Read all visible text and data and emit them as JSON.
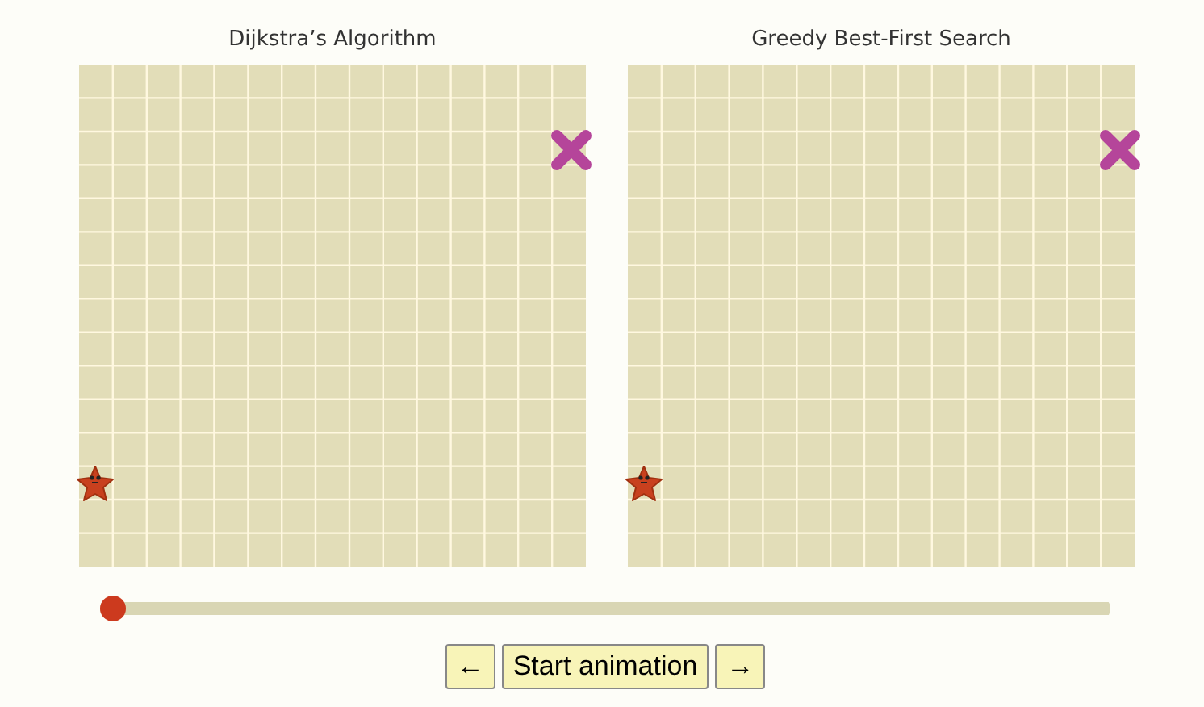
{
  "panels": [
    {
      "title": "Dijkstra’s Algorithm"
    },
    {
      "title": "Greedy Best-First Search"
    }
  ],
  "slider": {
    "level": 0
  },
  "buttons": [
    {
      "label": "←"
    },
    {
      "label": "Start animation"
    },
    {
      "label": "→"
    }
  ]
}
